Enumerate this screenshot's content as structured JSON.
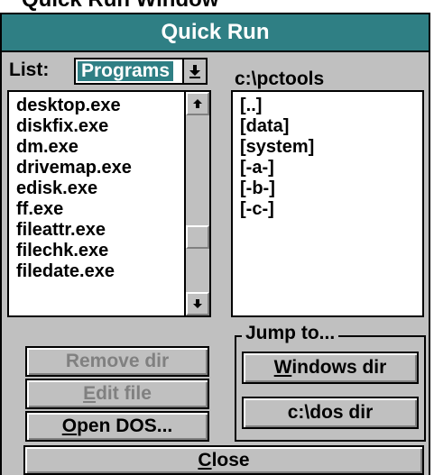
{
  "caption": "Quick Run Window",
  "window": {
    "title": "Quick Run"
  },
  "list_selector": {
    "label": "List:",
    "selected": "Programs"
  },
  "path": "c:\\pctools",
  "programs": [
    "desktop.exe",
    "diskfix.exe",
    "dm.exe",
    "drivemap.exe",
    "edisk.exe",
    "ff.exe",
    "fileattr.exe",
    "filechk.exe",
    "filedate.exe"
  ],
  "directories": [
    "[..]",
    "[data]",
    "[system]",
    "[-a-]",
    "[-b-]",
    "[-c-]"
  ],
  "buttons": {
    "remove_dir": "Remove dir",
    "edit_file_u": "E",
    "edit_file_rest": "dit file",
    "open_dos_u": "O",
    "open_dos_rest": "pen DOS...",
    "close_u": "C",
    "close_rest": "lose"
  },
  "jump_to": {
    "title": "Jump to...",
    "windows_dir_u": "W",
    "windows_dir_rest": "indows dir",
    "dos_dir": "c:\\dos dir"
  }
}
